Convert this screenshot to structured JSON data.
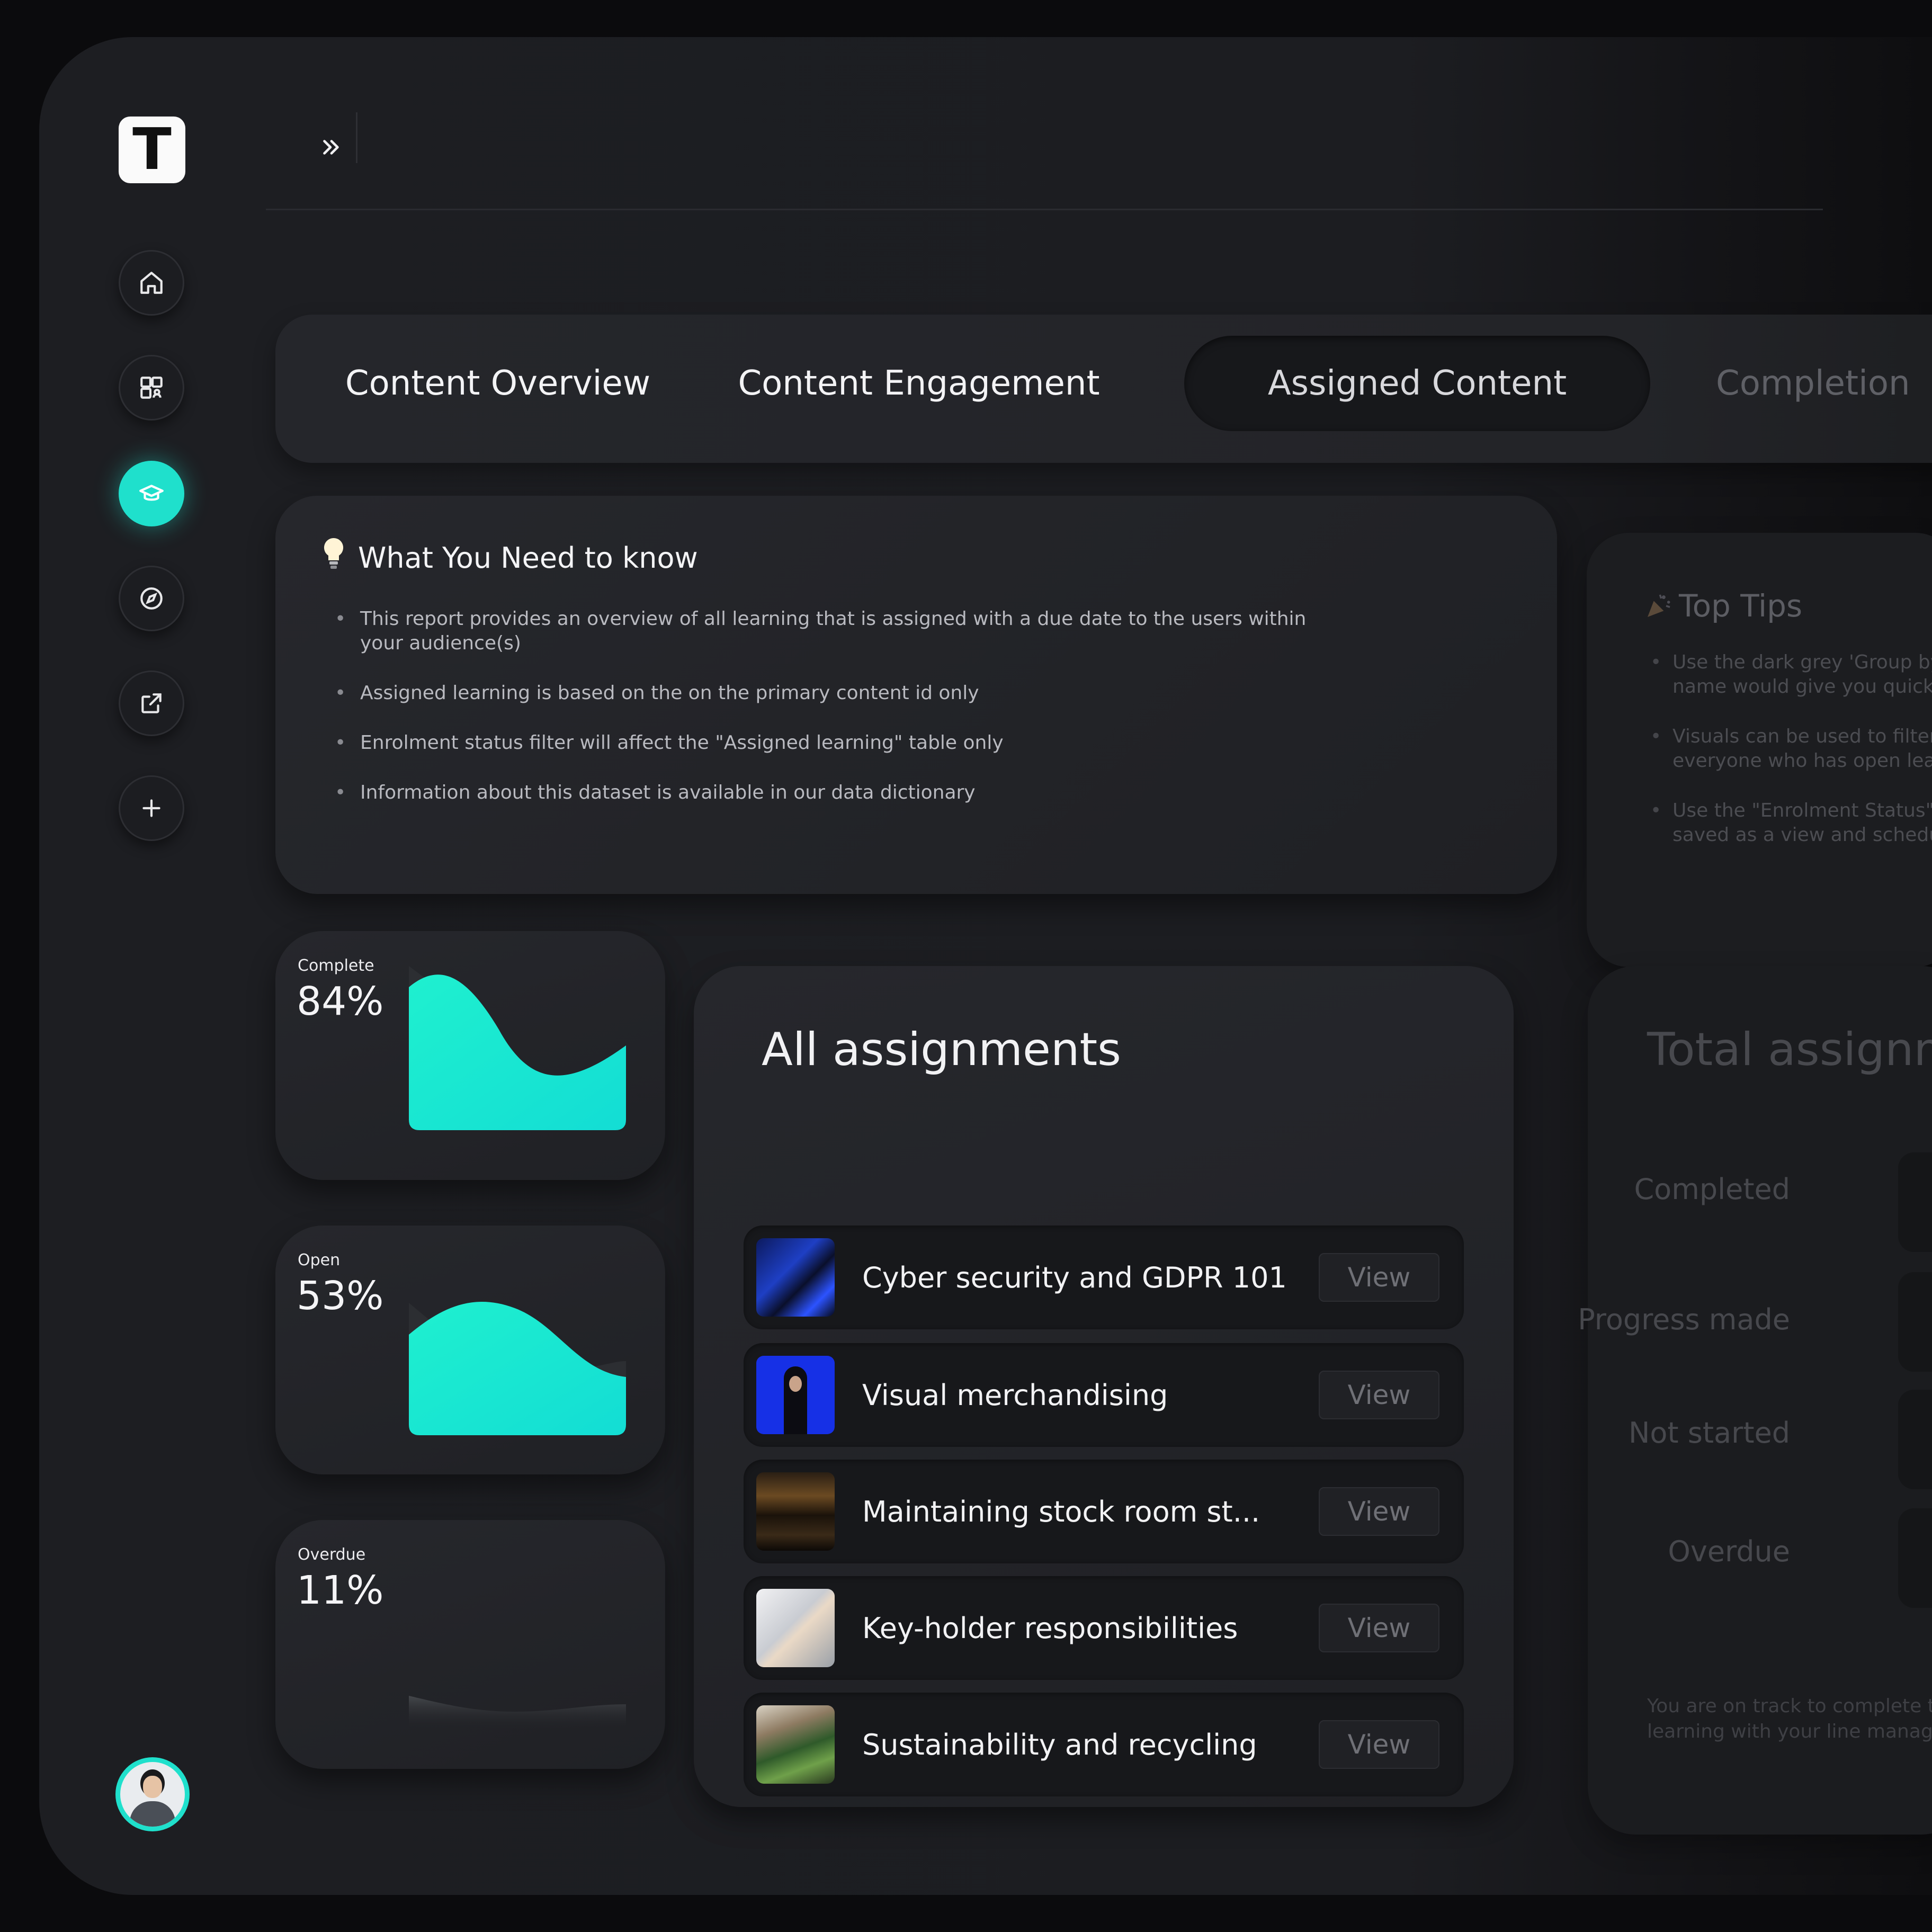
{
  "app": {
    "logo_letter": "T"
  },
  "sidebar": {
    "items": [
      {
        "icon": "home-icon",
        "active": false
      },
      {
        "icon": "content-library-icon",
        "active": false
      },
      {
        "icon": "graduation-cap-icon",
        "active": true
      },
      {
        "icon": "compass-icon",
        "active": false
      },
      {
        "icon": "external-link-icon",
        "active": false
      },
      {
        "icon": "plus-icon",
        "active": false
      }
    ],
    "avatar": "user-avatar"
  },
  "topbar": {
    "expand_icon": "double-chevron-right-icon"
  },
  "tabs": [
    {
      "label": "Content Overview",
      "active": false
    },
    {
      "label": "Content Engagement",
      "active": false
    },
    {
      "label": "Assigned Content",
      "active": true
    },
    {
      "label": "Completion",
      "active": false
    }
  ],
  "info": {
    "icon": "lightbulb-icon",
    "title": "What You Need to know",
    "bullets": [
      "This report provides an overview of all learning that is assigned with a due date to the users within your audience(s)",
      "Assigned learning is based on the on the primary content id only",
      "Enrolment status filter will affect the \"Assigned learning\" table only",
      "Information about this dataset is available in our data dictionary"
    ]
  },
  "tips": {
    "icon": "party-popper-icon",
    "title": "Top Tips",
    "bullets": [
      [
        "Use the dark grey 'Group by'",
        "name would give you quick"
      ],
      [
        "Visuals can be used to filter",
        "everyone who has open lear"
      ],
      [
        "Use the \"Enrolment Status\" f",
        "saved as a view and schedu"
      ]
    ]
  },
  "stats": [
    {
      "label": "Complete",
      "value": "84%",
      "fraction": 0.84
    },
    {
      "label": "Open",
      "value": "53%",
      "fraction": 0.53
    },
    {
      "label": "Overdue",
      "value": "11%",
      "fraction": 0.11
    }
  ],
  "assignments": {
    "title": "All assignments",
    "view_label": "View",
    "items": [
      {
        "name": "Cyber security and GDPR 101",
        "thumb": "cyber-security-thumbnail"
      },
      {
        "name": "Visual merchandising",
        "thumb": "visual-merchandising-thumbnail"
      },
      {
        "name": "Maintaining stock room st...",
        "thumb": "stock-room-thumbnail"
      },
      {
        "name": "Key-holder responsibilities",
        "thumb": "handshake-thumbnail"
      },
      {
        "name": "Sustainability and recycling",
        "thumb": "sustainability-thumbnail"
      }
    ]
  },
  "total": {
    "title": "Total assignm",
    "rows": [
      "Completed",
      "Progress made",
      "Not started",
      "Overdue"
    ],
    "footer": [
      "You are on track to complete t",
      "learning with your line manag"
    ]
  },
  "colors": {
    "accent": "#1fe0cc",
    "background": "#1d1e22",
    "card": "#25262b"
  }
}
